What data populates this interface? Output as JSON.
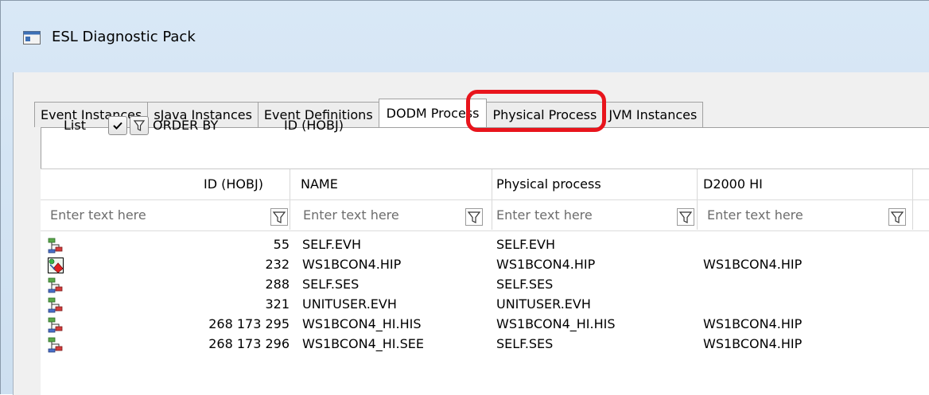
{
  "window": {
    "title": "ESL Diagnostic Pack"
  },
  "tabs": [
    {
      "label": "Event Instances"
    },
    {
      "label": "sJava Instances"
    },
    {
      "label": "Event Definitions"
    },
    {
      "label": "DODM Process",
      "active": true
    },
    {
      "label": "Physical Process"
    },
    {
      "label": "JVM Instances"
    }
  ],
  "toolbar": {
    "list_label": "List",
    "order_by_label": "ORDER BY",
    "order_by_field": "ID (HOBJ)"
  },
  "grid": {
    "columns": [
      "ID (HOBJ)",
      "NAME",
      "Physical process",
      "D2000 HI"
    ],
    "filter_placeholder": "Enter text here",
    "rows": [
      {
        "icon": "hierarchy-object-icon",
        "id": "55",
        "name": "SELF.EVH",
        "physical": "SELF.EVH",
        "hi": ""
      },
      {
        "icon": "hip-process-icon",
        "id": "232",
        "name": "WS1BCON4.HIP",
        "physical": "WS1BCON4.HIP",
        "hi": "WS1BCON4.HIP"
      },
      {
        "icon": "hierarchy-object-icon",
        "id": "288",
        "name": "SELF.SES",
        "physical": "SELF.SES",
        "hi": ""
      },
      {
        "icon": "hierarchy-object-icon",
        "id": "321",
        "name": "UNITUSER.EVH",
        "physical": "UNITUSER.EVH",
        "hi": ""
      },
      {
        "icon": "hierarchy-object-icon",
        "id": "268 173 295",
        "name": "WS1BCON4_HI.HIS",
        "physical": "WS1BCON4_HI.HIS",
        "hi": "WS1BCON4.HIP"
      },
      {
        "icon": "hierarchy-object-icon",
        "id": "268 173 296",
        "name": "WS1BCON4_HI.SEE",
        "physical": "SELF.SES",
        "hi": "WS1BCON4.HIP"
      }
    ]
  },
  "colors": {
    "highlight": "#e8141c",
    "titlebar": "#d9e8f6"
  }
}
